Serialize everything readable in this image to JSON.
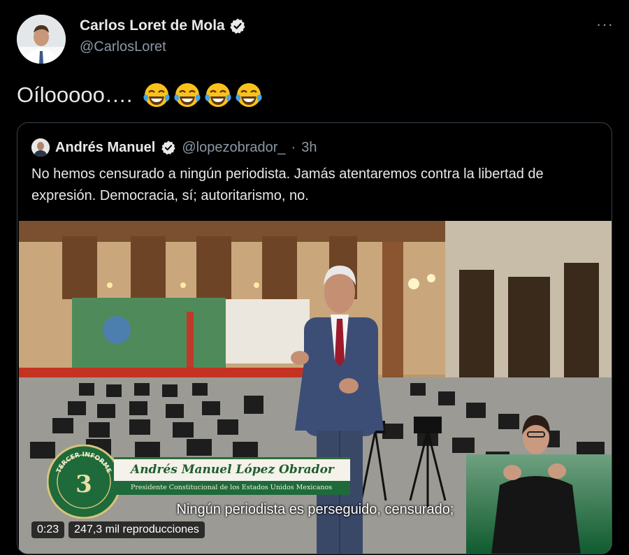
{
  "tweet": {
    "author_name": "Carlos Loret de Mola",
    "author_handle": "@CarlosLoret",
    "text": "Oílooooo….",
    "emojis": [
      "face-with-tears-of-joy",
      "face-with-tears-of-joy",
      "face-with-tears-of-joy",
      "face-with-tears-of-joy"
    ],
    "more_label": "···"
  },
  "quoted": {
    "author_name": "Andrés Manuel",
    "author_handle": "@lopezobrador_",
    "separator": "·",
    "time": "3h",
    "text": "No hemos censurado a ningún periodista. Jamás atentaremos contra la libertad de expresión. Democracia, sí; autoritarismo, no."
  },
  "video": {
    "lower_third_name": "Andrés Manuel López Obrador",
    "lower_third_title": "Presidente Constitucional de los Estados Unidos Mexicanos",
    "caption": "Ningún periodista es perseguido, censurado;",
    "elapsed": "0:23",
    "views": "247,3 mil reproducciones",
    "seal_text": "TERCER INFORME"
  },
  "colors": {
    "background": "#000000",
    "text": "#e7e9ea",
    "secondary_text": "#8b98a5",
    "verified": "#e7e9ea",
    "border": "#38444d"
  }
}
